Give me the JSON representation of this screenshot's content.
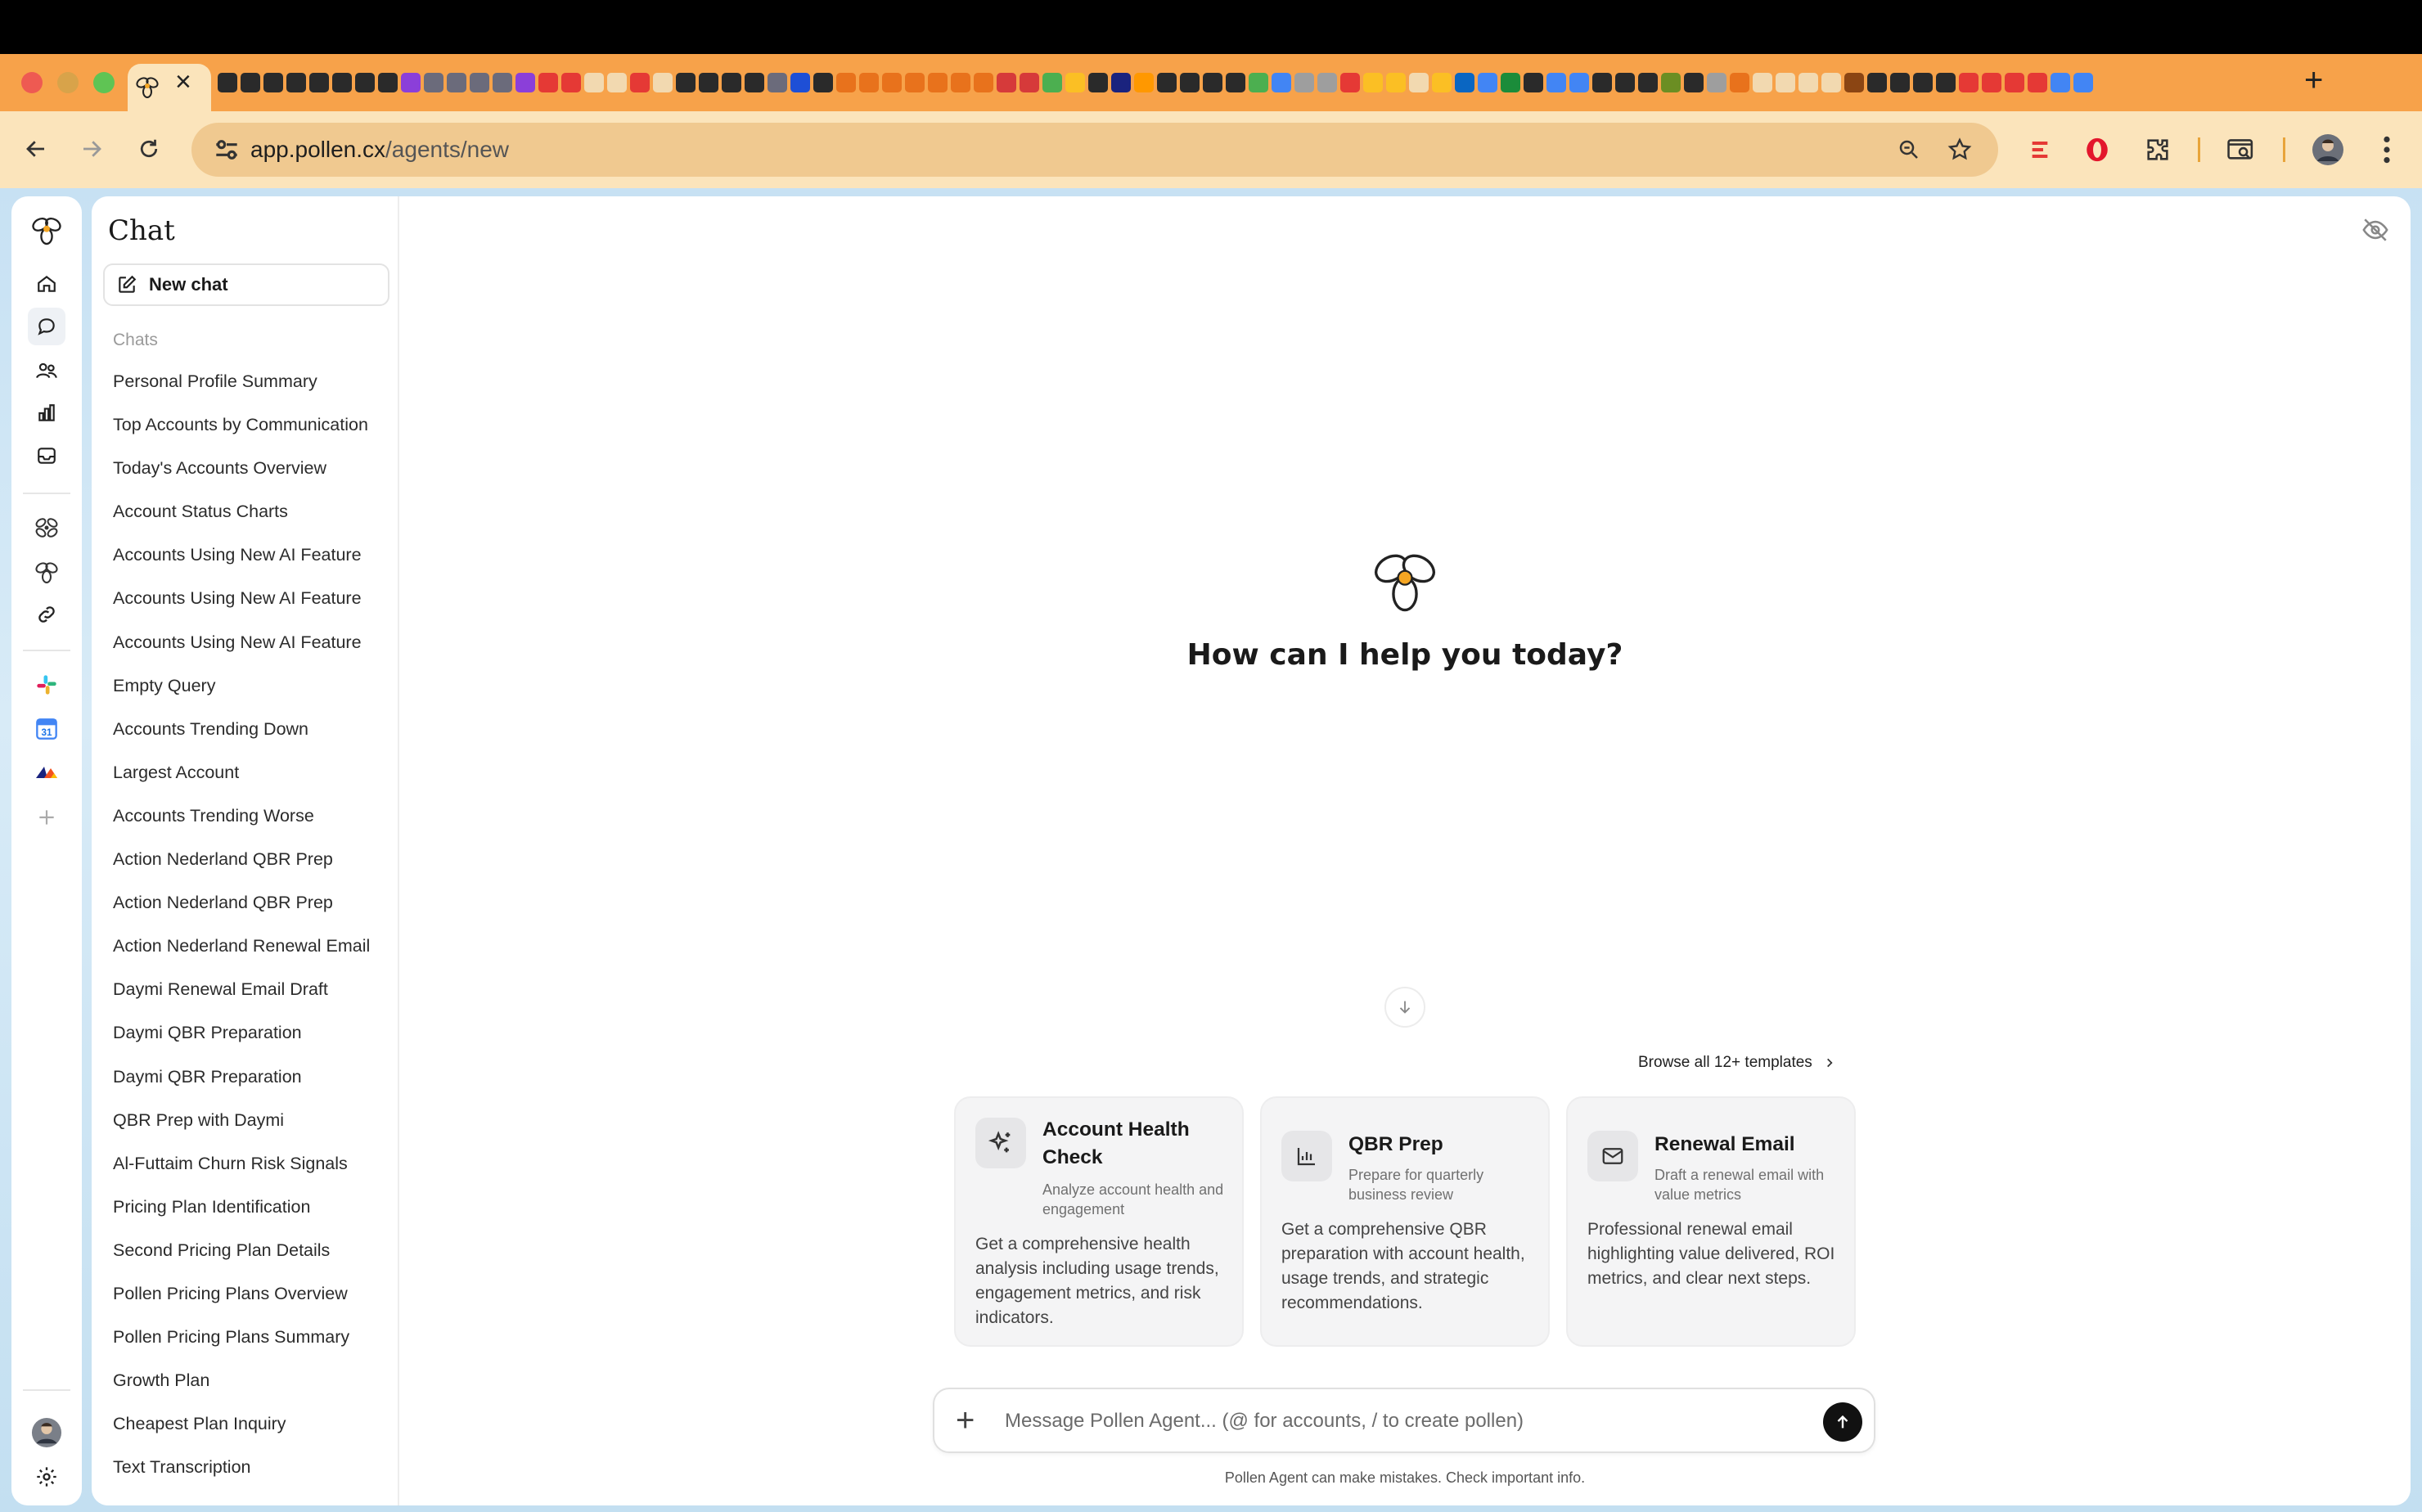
{
  "browser": {
    "url_host": "app.pollen.cx",
    "url_path": "/agents/new",
    "favicon_colors": [
      "#2a2a2a",
      "#2a2a2a",
      "#2a2a2a",
      "#2a2a2a",
      "#2a2a2a",
      "#2a2a2a",
      "#2a2a2a",
      "#2a2a2a",
      "#8b3fd9",
      "#6b6b7b",
      "#6b6b7b",
      "#6b6b7b",
      "#6b6b7b",
      "#8b3fd9",
      "#e53935",
      "#e53935",
      "#f2d9b0",
      "#f2d9b0",
      "#e53935",
      "#f2d9b0",
      "#2a2a2a",
      "#2a2a2a",
      "#2a2a2a",
      "#2a2a2a",
      "#6b6b7b",
      "#1e4fd6",
      "#2a2a2a",
      "#e8721c",
      "#e8721c",
      "#e8721c",
      "#e8721c",
      "#e8721c",
      "#e8721c",
      "#e8721c",
      "#d63a3a",
      "#d63a3a",
      "#4caf50",
      "#fbbf24",
      "#2a2a2a",
      "#1a237e",
      "#ff9800",
      "#2a2a2a",
      "#2a2a2a",
      "#2a2a2a",
      "#2a2a2a",
      "#4caf50",
      "#4285f4",
      "#9e9e9e",
      "#9e9e9e",
      "#e53935",
      "#fbbf24",
      "#fbbf24",
      "#f2d9b0",
      "#fbbf24",
      "#0a66c2",
      "#4285f4",
      "#1b8c3a",
      "#2a2a2a",
      "#4285f4",
      "#4285f4",
      "#2a2a2a",
      "#2a2a2a",
      "#2a2a2a",
      "#6b8e23",
      "#2a2a2a",
      "#9e9e9e",
      "#e8721c",
      "#f2d9b0",
      "#f2d9b0",
      "#f2d9b0",
      "#f2d9b0",
      "#8b4513",
      "#2a2a2a",
      "#2a2a2a",
      "#2a2a2a",
      "#2a2a2a",
      "#e53935",
      "#e53935",
      "#e53935",
      "#e53935",
      "#4285f4",
      "#4285f4"
    ]
  },
  "sidebar": {
    "title": "Chat",
    "new_chat_label": "New chat",
    "section_label": "Chats",
    "chats": [
      "Personal Profile Summary",
      "Top Accounts by Communication",
      "Today's Accounts Overview",
      "Account Status Charts",
      "Accounts Using New AI Feature",
      "Accounts Using New AI Feature",
      "Accounts Using New AI Feature",
      "Empty Query",
      "Accounts Trending Down",
      "Largest Account",
      "Accounts Trending Worse",
      "Action Nederland QBR Prep",
      "Action Nederland QBR Prep",
      "Action Nederland Renewal Email",
      "Daymi Renewal Email Draft",
      "Daymi QBR Preparation",
      "Daymi QBR Preparation",
      "QBR Prep with Daymi",
      "Al-Futtaim Churn Risk Signals",
      "Pricing Plan Identification",
      "Second Pricing Plan Details",
      "Pollen Pricing Plans Overview",
      "Pollen Pricing Plans Summary",
      "Growth Plan",
      "Cheapest Plan Inquiry",
      "Text Transcription"
    ]
  },
  "main": {
    "greeting": "How can I help you today?",
    "browse_label": "Browse all 12+ templates",
    "cards": [
      {
        "title": "Account Health Check",
        "subtitle": "Analyze account health and engagement",
        "body": "Get a comprehensive health analysis including usage trends, engagement metrics, and risk indicators."
      },
      {
        "title": "QBR Prep",
        "subtitle": "Prepare for quarterly business review",
        "body": "Get a comprehensive QBR preparation with account health, usage trends, and strategic recommendations."
      },
      {
        "title": "Renewal Email",
        "subtitle": "Draft a renewal email with value metrics",
        "body": "Professional renewal email highlighting value delivered, ROI metrics, and clear next steps."
      }
    ],
    "composer_placeholder": "Message Pollen Agent... (@ for accounts, / to create pollen)",
    "disclaimer": "Pollen Agent can make mistakes. Check important info."
  }
}
